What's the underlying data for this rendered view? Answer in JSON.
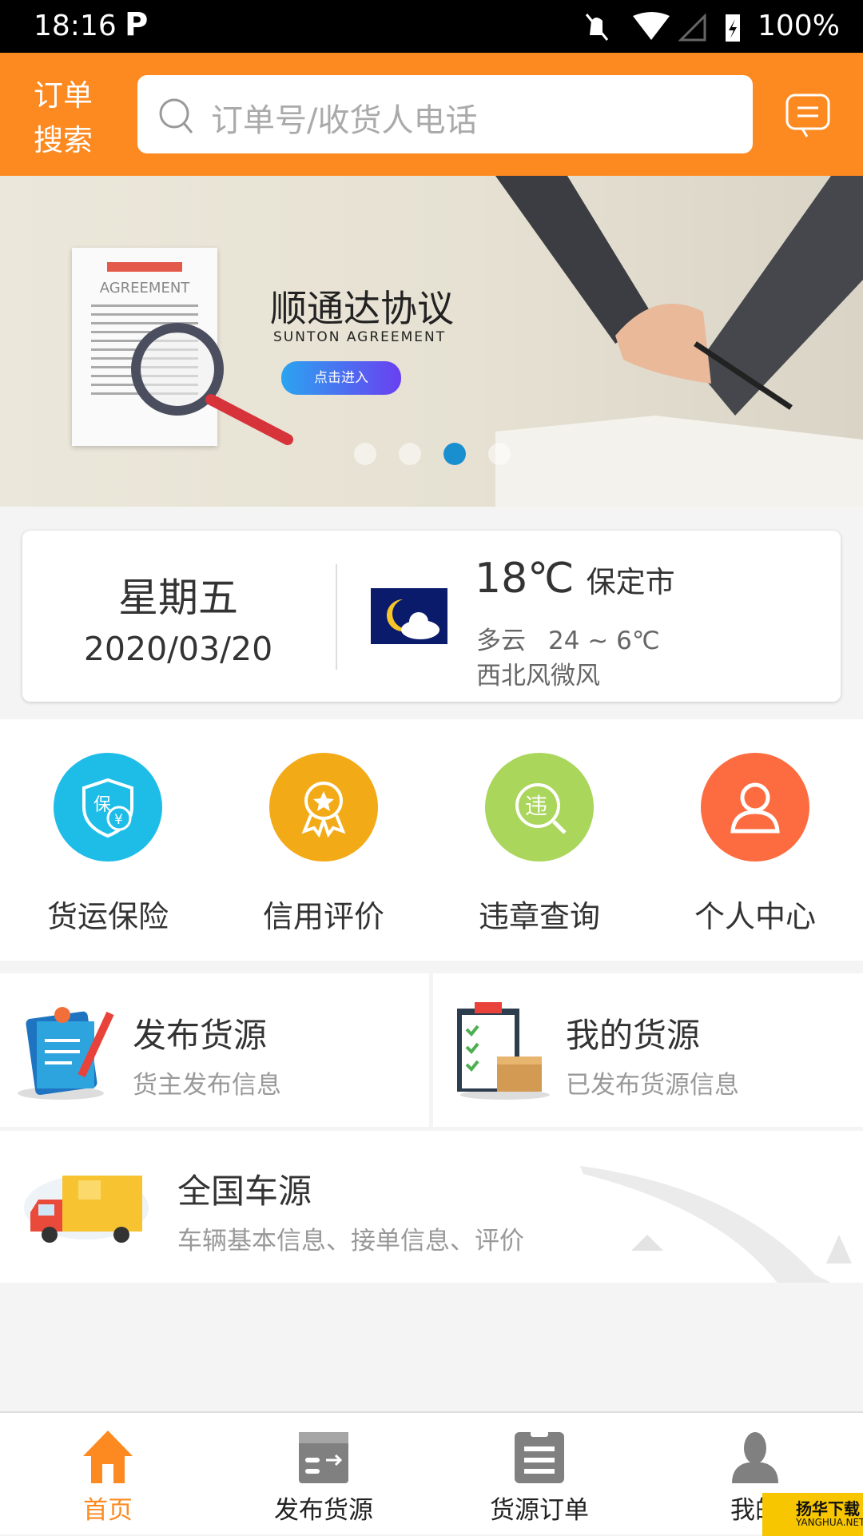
{
  "status_bar": {
    "time": "18:16",
    "battery": "100%"
  },
  "header": {
    "title_line1": "订单",
    "title_line2": "搜索",
    "search_placeholder": "订单号/收货人电话"
  },
  "banner": {
    "title": "顺通达协议",
    "subtitle": "SUNTON AGREEMENT",
    "cta": "点击进入",
    "doc_label": "AGREEMENT",
    "active_dot": 3,
    "dot_count": 4
  },
  "weather": {
    "weekday": "星期五",
    "date": "2020/03/20",
    "temperature": "18℃",
    "city": "保定市",
    "condition": "多云",
    "range": "24 ~ 6℃",
    "wind": "西北风微风"
  },
  "quick_actions": [
    {
      "label": "货运保险",
      "color": "#1ebde8",
      "icon": "insurance-shield-icon"
    },
    {
      "label": "信用评价",
      "color": "#f3aa17",
      "icon": "medal-icon"
    },
    {
      "label": "违章查询",
      "color": "#a9d65b",
      "icon": "violation-search-icon"
    },
    {
      "label": "个人中心",
      "color": "#fd6c41",
      "icon": "person-icon"
    }
  ],
  "services": [
    {
      "title": "发布货源",
      "desc": "货主发布信息"
    },
    {
      "title": "我的货源",
      "desc": "已发布货源信息"
    },
    {
      "title": "全国车源",
      "desc": "车辆基本信息、接单信息、评价"
    }
  ],
  "bottom_nav": [
    {
      "label": "首页",
      "active": true
    },
    {
      "label": "发布货源"
    },
    {
      "label": "货源订单"
    },
    {
      "label": "我的"
    }
  ],
  "watermark": {
    "text": "扬华下载",
    "sub": "YANGHUA.NET"
  },
  "colors": {
    "accent": "#fd8a20",
    "nav_inactive": "#808080"
  }
}
